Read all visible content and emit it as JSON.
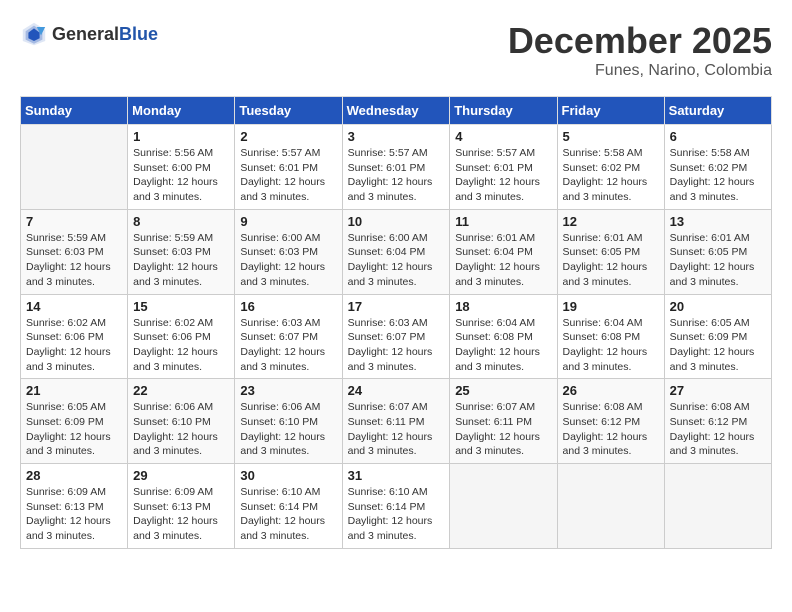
{
  "logo": {
    "general": "General",
    "blue": "Blue"
  },
  "title": "December 2025",
  "subtitle": "Funes, Narino, Colombia",
  "weekdays": [
    "Sunday",
    "Monday",
    "Tuesday",
    "Wednesday",
    "Thursday",
    "Friday",
    "Saturday"
  ],
  "weeks": [
    [
      {
        "day": "",
        "info": ""
      },
      {
        "day": "1",
        "info": "Sunrise: 5:56 AM\nSunset: 6:00 PM\nDaylight: 12 hours\nand 3 minutes."
      },
      {
        "day": "2",
        "info": "Sunrise: 5:57 AM\nSunset: 6:01 PM\nDaylight: 12 hours\nand 3 minutes."
      },
      {
        "day": "3",
        "info": "Sunrise: 5:57 AM\nSunset: 6:01 PM\nDaylight: 12 hours\nand 3 minutes."
      },
      {
        "day": "4",
        "info": "Sunrise: 5:57 AM\nSunset: 6:01 PM\nDaylight: 12 hours\nand 3 minutes."
      },
      {
        "day": "5",
        "info": "Sunrise: 5:58 AM\nSunset: 6:02 PM\nDaylight: 12 hours\nand 3 minutes."
      },
      {
        "day": "6",
        "info": "Sunrise: 5:58 AM\nSunset: 6:02 PM\nDaylight: 12 hours\nand 3 minutes."
      }
    ],
    [
      {
        "day": "7",
        "info": "Sunrise: 5:59 AM\nSunset: 6:03 PM\nDaylight: 12 hours\nand 3 minutes."
      },
      {
        "day": "8",
        "info": "Sunrise: 5:59 AM\nSunset: 6:03 PM\nDaylight: 12 hours\nand 3 minutes."
      },
      {
        "day": "9",
        "info": "Sunrise: 6:00 AM\nSunset: 6:03 PM\nDaylight: 12 hours\nand 3 minutes."
      },
      {
        "day": "10",
        "info": "Sunrise: 6:00 AM\nSunset: 6:04 PM\nDaylight: 12 hours\nand 3 minutes."
      },
      {
        "day": "11",
        "info": "Sunrise: 6:01 AM\nSunset: 6:04 PM\nDaylight: 12 hours\nand 3 minutes."
      },
      {
        "day": "12",
        "info": "Sunrise: 6:01 AM\nSunset: 6:05 PM\nDaylight: 12 hours\nand 3 minutes."
      },
      {
        "day": "13",
        "info": "Sunrise: 6:01 AM\nSunset: 6:05 PM\nDaylight: 12 hours\nand 3 minutes."
      }
    ],
    [
      {
        "day": "14",
        "info": "Sunrise: 6:02 AM\nSunset: 6:06 PM\nDaylight: 12 hours\nand 3 minutes."
      },
      {
        "day": "15",
        "info": "Sunrise: 6:02 AM\nSunset: 6:06 PM\nDaylight: 12 hours\nand 3 minutes."
      },
      {
        "day": "16",
        "info": "Sunrise: 6:03 AM\nSunset: 6:07 PM\nDaylight: 12 hours\nand 3 minutes."
      },
      {
        "day": "17",
        "info": "Sunrise: 6:03 AM\nSunset: 6:07 PM\nDaylight: 12 hours\nand 3 minutes."
      },
      {
        "day": "18",
        "info": "Sunrise: 6:04 AM\nSunset: 6:08 PM\nDaylight: 12 hours\nand 3 minutes."
      },
      {
        "day": "19",
        "info": "Sunrise: 6:04 AM\nSunset: 6:08 PM\nDaylight: 12 hours\nand 3 minutes."
      },
      {
        "day": "20",
        "info": "Sunrise: 6:05 AM\nSunset: 6:09 PM\nDaylight: 12 hours\nand 3 minutes."
      }
    ],
    [
      {
        "day": "21",
        "info": "Sunrise: 6:05 AM\nSunset: 6:09 PM\nDaylight: 12 hours\nand 3 minutes."
      },
      {
        "day": "22",
        "info": "Sunrise: 6:06 AM\nSunset: 6:10 PM\nDaylight: 12 hours\nand 3 minutes."
      },
      {
        "day": "23",
        "info": "Sunrise: 6:06 AM\nSunset: 6:10 PM\nDaylight: 12 hours\nand 3 minutes."
      },
      {
        "day": "24",
        "info": "Sunrise: 6:07 AM\nSunset: 6:11 PM\nDaylight: 12 hours\nand 3 minutes."
      },
      {
        "day": "25",
        "info": "Sunrise: 6:07 AM\nSunset: 6:11 PM\nDaylight: 12 hours\nand 3 minutes."
      },
      {
        "day": "26",
        "info": "Sunrise: 6:08 AM\nSunset: 6:12 PM\nDaylight: 12 hours\nand 3 minutes."
      },
      {
        "day": "27",
        "info": "Sunrise: 6:08 AM\nSunset: 6:12 PM\nDaylight: 12 hours\nand 3 minutes."
      }
    ],
    [
      {
        "day": "28",
        "info": "Sunrise: 6:09 AM\nSunset: 6:13 PM\nDaylight: 12 hours\nand 3 minutes."
      },
      {
        "day": "29",
        "info": "Sunrise: 6:09 AM\nSunset: 6:13 PM\nDaylight: 12 hours\nand 3 minutes."
      },
      {
        "day": "30",
        "info": "Sunrise: 6:10 AM\nSunset: 6:14 PM\nDaylight: 12 hours\nand 3 minutes."
      },
      {
        "day": "31",
        "info": "Sunrise: 6:10 AM\nSunset: 6:14 PM\nDaylight: 12 hours\nand 3 minutes."
      },
      {
        "day": "",
        "info": ""
      },
      {
        "day": "",
        "info": ""
      },
      {
        "day": "",
        "info": ""
      }
    ]
  ]
}
